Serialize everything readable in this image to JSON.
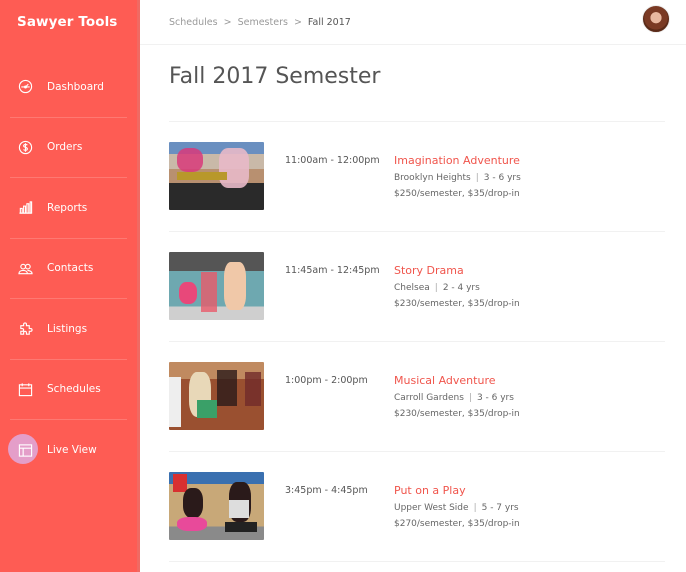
{
  "app": {
    "title": "Sawyer Tools"
  },
  "sidebar": {
    "items": [
      {
        "label": "Dashboard",
        "icon": "dashboard-gauge-icon"
      },
      {
        "label": "Orders",
        "icon": "dollar-icon"
      },
      {
        "label": "Reports",
        "icon": "bar-chart-icon"
      },
      {
        "label": "Contacts",
        "icon": "contacts-icon"
      },
      {
        "label": "Listings",
        "icon": "puzzle-icon"
      },
      {
        "label": "Schedules",
        "icon": "calendar-icon"
      },
      {
        "label": "Live View",
        "icon": "layout-icon"
      }
    ],
    "accent": "#fe5c54",
    "active_highlight": "#e49ec9"
  },
  "breadcrumb": {
    "items": [
      "Schedules",
      "Semesters",
      "Fall 2017"
    ],
    "separator": ">"
  },
  "page": {
    "title": "Fall 2017 Semester"
  },
  "classes": [
    {
      "time": "11:00am - 12:00pm",
      "title": "Imagination Adventure",
      "location": "Brooklyn Heights",
      "ages": "3 - 6 yrs",
      "price": "$250/semester, $35/drop-in"
    },
    {
      "time": "11:45am - 12:45pm",
      "title": "Story Drama",
      "location": "Chelsea",
      "ages": "2 - 4 yrs",
      "price": "$230/semester, $35/drop-in"
    },
    {
      "time": "1:00pm - 2:00pm",
      "title": "Musical Adventure",
      "location": "Carroll Gardens",
      "ages": "3 - 6 yrs",
      "price": "$230/semester, $35/drop-in"
    },
    {
      "time": "3:45pm - 4:45pm",
      "title": "Put on a Play",
      "location": "Upper West Side",
      "ages": "5 - 7 yrs",
      "price": "$270/semester, $35/drop-in"
    }
  ],
  "meta_separator": "|"
}
